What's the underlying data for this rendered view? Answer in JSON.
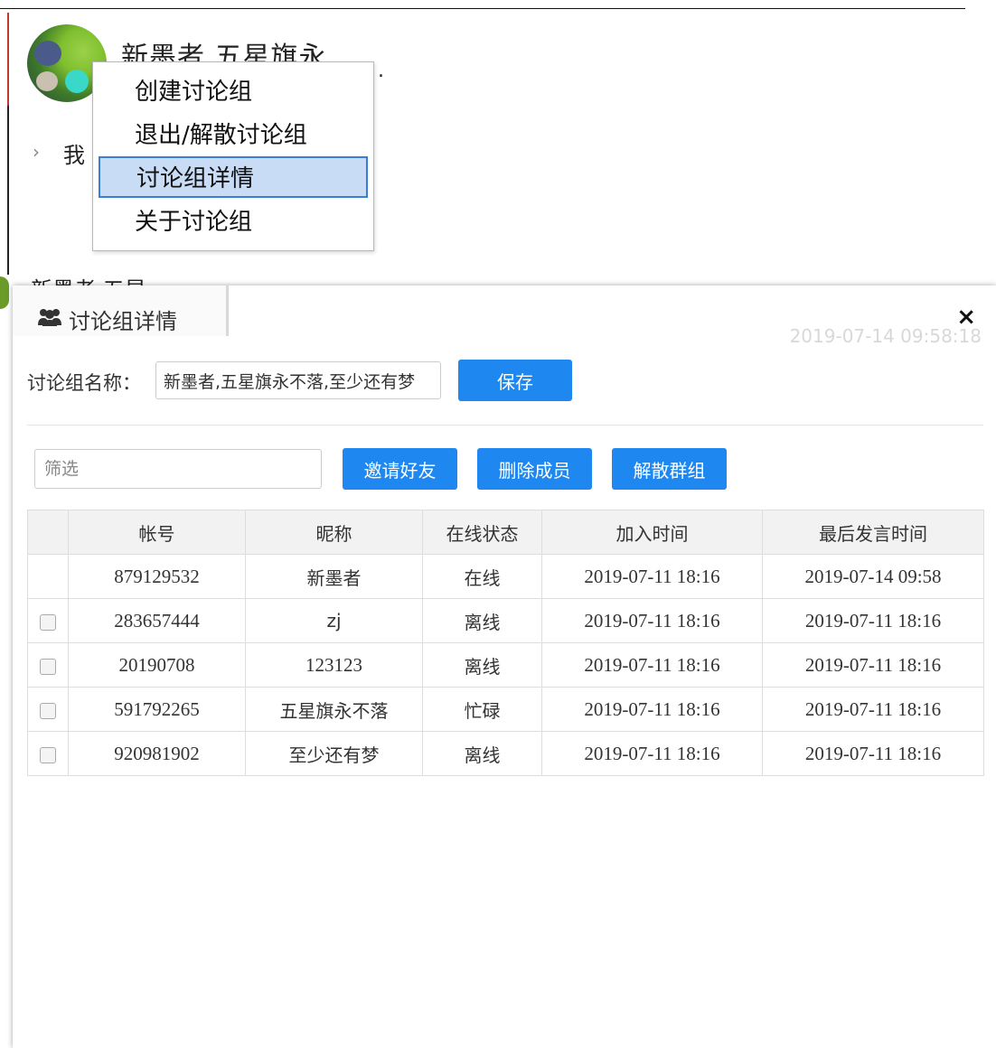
{
  "background": {
    "group_title": "新墨者,五星旗永",
    "side_item": "我",
    "group_name_short": "新墨者,五星..."
  },
  "context_menu": {
    "items": [
      "创建讨论组",
      "退出/解散讨论组",
      "讨论组详情",
      "关于讨论组"
    ],
    "selected": "讨论组详情"
  },
  "modal": {
    "title": "讨论组详情",
    "timestamp": "2019-07-14 09:58:18",
    "close_label": "×",
    "name_label": "讨论组名称：",
    "name_value": "新墨者,五星旗永不落,至少还有梦",
    "save_label": "保存",
    "filter_placeholder": "筛选",
    "invite_label": "邀请好友",
    "remove_label": "删除成员",
    "dissolve_label": "解散群组",
    "table": {
      "headers": [
        "",
        "帐号",
        "昵称",
        "在线状态",
        "加入时间",
        "最后发言时间"
      ],
      "rows": [
        {
          "checkbox": false,
          "account": "879129532",
          "nickname": "新墨者",
          "status": "在线",
          "joined": "2019-07-11 18:16",
          "last_spoke": "2019-07-14 09:58"
        },
        {
          "checkbox": true,
          "account": "283657444",
          "nickname": "zj",
          "status": "离线",
          "joined": "2019-07-11 18:16",
          "last_spoke": "2019-07-11 18:16"
        },
        {
          "checkbox": true,
          "account": "20190708",
          "nickname": "123123",
          "status": "离线",
          "joined": "2019-07-11 18:16",
          "last_spoke": "2019-07-11 18:16"
        },
        {
          "checkbox": true,
          "account": "591792265",
          "nickname": "五星旗永不落",
          "status": "忙碌",
          "joined": "2019-07-11 18:16",
          "last_spoke": "2019-07-11 18:16"
        },
        {
          "checkbox": true,
          "account": "920981902",
          "nickname": "至少还有梦",
          "status": "离线",
          "joined": "2019-07-11 18:16",
          "last_spoke": "2019-07-11 18:16"
        }
      ]
    }
  },
  "colors": {
    "primary_button": "#1e88f0",
    "menu_selected_bg": "#c8dcf5",
    "menu_selected_border": "#3a7dd6"
  }
}
